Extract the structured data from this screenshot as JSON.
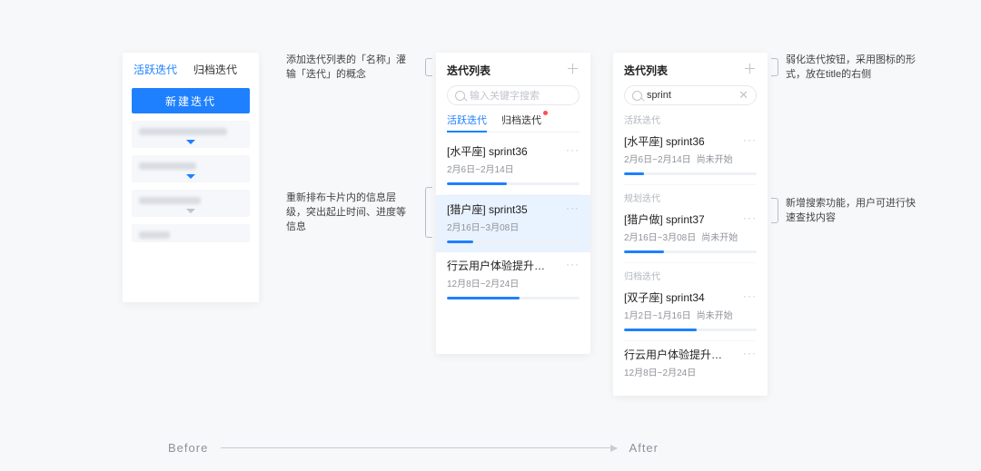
{
  "before": {
    "tab_active": "活跃迭代",
    "tab_archive": "归档迭代",
    "new_btn": "新建迭代"
  },
  "annotations": {
    "a1": "添加迭代列表的「名称」灌输「迭代」的概念",
    "a2": "重新排布卡片内的信息层级，突出起止时间、进度等信息",
    "a3": "弱化迭代按钮，采用图标的形式，放在title的右侧",
    "a4": "新增搜索功能，用户可进行快速查找内容"
  },
  "after1": {
    "title": "迭代列表",
    "search_placeholder": "输入关键字搜索",
    "tab_active": "活跃迭代",
    "tab_archive": "归档迭代",
    "items": [
      {
        "name": "[水平座] sprint36",
        "range": "2月6日~2月14日",
        "progress": 45
      },
      {
        "name": "[猎户座] sprint35",
        "range": "2月16日~3月08日",
        "progress": 20,
        "selected": true
      },
      {
        "name": "行云用户体验提升的迭...",
        "range": "12月8日~2月24日",
        "progress": 55
      }
    ]
  },
  "after2": {
    "title": "迭代列表",
    "search_value": "sprint",
    "sections": [
      {
        "label": "活跃迭代",
        "items": [
          {
            "name": "[水平座] sprint36",
            "range": "2月6日~2月14日",
            "status": "尚未开始",
            "progress": 15
          }
        ]
      },
      {
        "label": "规划迭代",
        "items": [
          {
            "name": "[猎户做] sprint37",
            "range": "2月16日~3月08日",
            "status": "尚未开始",
            "progress": 30
          }
        ]
      },
      {
        "label": "归档迭代",
        "items": [
          {
            "name": "[双子座] sprint34",
            "range": "1月2日~1月16日",
            "status": "尚未开始",
            "progress": 55
          },
          {
            "name": "行云用户体验提升的迭...",
            "range": "12月8日~2月24日",
            "progress": 0
          }
        ]
      }
    ]
  },
  "labels": {
    "before": "Before",
    "after": "After"
  }
}
